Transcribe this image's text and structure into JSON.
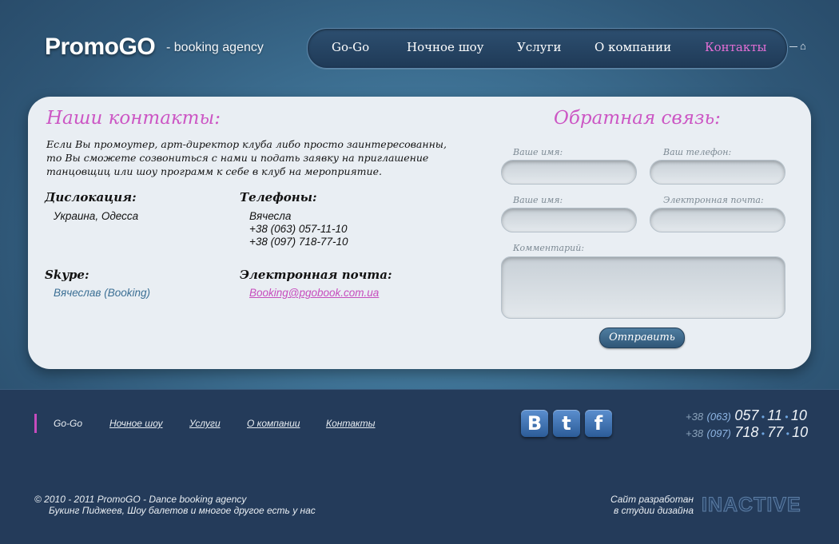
{
  "brand": {
    "logo": "PromoGO",
    "tagline": "- booking agency"
  },
  "nav": {
    "items": [
      "Go-Go",
      "Ночное шоу",
      "Услуги",
      "О компании",
      "Контакты"
    ],
    "active": "Контакты",
    "active_color": "#e56fd6"
  },
  "contacts": {
    "title": "Наши контакты:",
    "intro": "Если Вы промоутер, арт-директор клуба либо просто заинтересованны, то Вы сможете созвониться с нами и подать заявку на приглашение танцовщиц или шоу программ к себе в клуб на мероприятие.",
    "location_label": "Дислокация:",
    "location_value": "Украина, Одесса",
    "phones_label": "Телефоны:",
    "phones": [
      "Вячесла",
      "+38 (063) 057-11-10",
      "+38 (097) 718-77-10"
    ],
    "skype_label": "Skype:",
    "skype_value": "Вячеслав (Booking)",
    "email_label": "Электронная почта:",
    "email_value": "Booking@pgobook.com.ua"
  },
  "feedback": {
    "title": "Обратная связь:",
    "fields": [
      "Ваше имя:",
      "Ваш телефон:",
      "Ваше имя:",
      "Электронная почта:"
    ],
    "comment_label": "Комментарий:",
    "submit_label": "Отправить"
  },
  "footer": {
    "links": [
      "Go-Go",
      "Ночное шоу",
      "Услуги",
      "О компании",
      "Контакты"
    ],
    "social": [
      "vkontakte-icon",
      "twitter-icon",
      "facebook-icon"
    ],
    "phones": [
      {
        "prefix": "+38",
        "code": "(063)",
        "a": "057",
        "b": "11",
        "c": "10"
      },
      {
        "prefix": "+38",
        "code": "(097)",
        "a": "718",
        "b": "77",
        "c": "10"
      }
    ],
    "copyright_1": "©  2010 - 2011 PromoGO - Dance booking agency",
    "copyright_2": "Букинг Пиджеев, Шоу балетов и многое другое есть у нас",
    "dev_1": "Сайт разработан",
    "dev_2": "в студии дизайна",
    "studio": "INACTIVE"
  }
}
